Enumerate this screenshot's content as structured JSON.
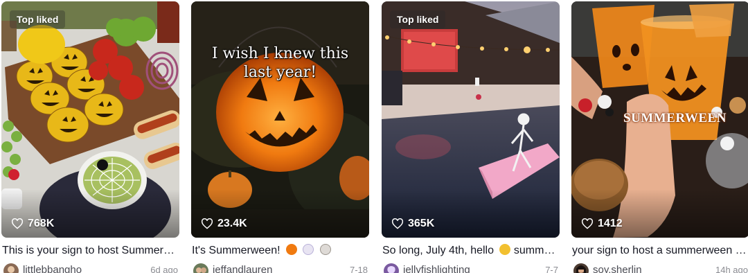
{
  "videos": [
    {
      "badge": "Top liked",
      "likes": "768K",
      "caption": "This is your sign to host Summerween",
      "author": "littlebbangho",
      "date": "6d ago",
      "overlay": "",
      "colors": {
        "avatar": "#8a6a55"
      }
    },
    {
      "badge": "",
      "likes": "23.4K",
      "caption": "It's Summerween!",
      "author": "jeffandlauren",
      "date": "7-18",
      "overlay_line1": "I wish I knew this",
      "overlay_line2": "last year!",
      "colors": {
        "avatar": "#6a7a5a"
      }
    },
    {
      "badge": "Top liked",
      "likes": "365K",
      "caption": "So long, July 4th, hello",
      "caption_tail": "summerween",
      "author": "jellyfishlighting",
      "date": "7-7",
      "colors": {
        "avatar": "#7a5aa0"
      }
    },
    {
      "badge": "",
      "likes": "1412",
      "caption": "your sign to host a summerween party",
      "author": "soy.sherlin",
      "date": "14h ago",
      "overlay": "SUMMERWEEN",
      "colors": {
        "avatar": "#4a3a30"
      }
    }
  ],
  "icons": {
    "likes": "heart-outline-icon"
  }
}
